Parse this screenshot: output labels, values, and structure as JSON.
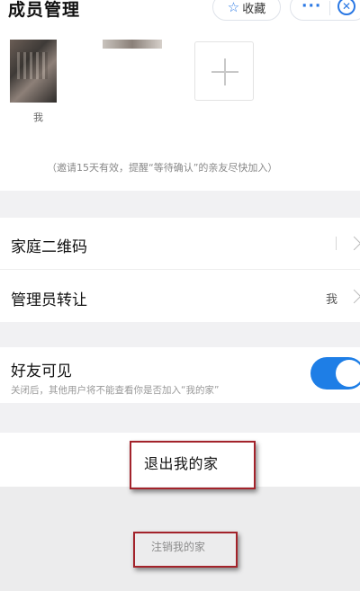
{
  "header": {
    "title": "成员管理",
    "favorite_label": "收藏",
    "more_icon": "···",
    "close_icon": "✕"
  },
  "members": {
    "me_label": "我",
    "invite_note": "（邀请15天有效，提醒“等待确认”的亲友尽快加入）"
  },
  "settings": {
    "qr_label": "家庭二维码",
    "admin_transfer_label": "管理员转让",
    "admin_value": "我"
  },
  "friends_visible": {
    "label": "好友可见",
    "description": "关闭后，其他用户将不能查看你是否加入“我的家”",
    "enabled": true,
    "accent_color": "#1e7ee6"
  },
  "actions": {
    "exit_label": "退出我的家",
    "cancel_label": "注销我的家"
  },
  "colors": {
    "annotation_box": "#a3232b",
    "section_gap": "#f1f1f3"
  }
}
